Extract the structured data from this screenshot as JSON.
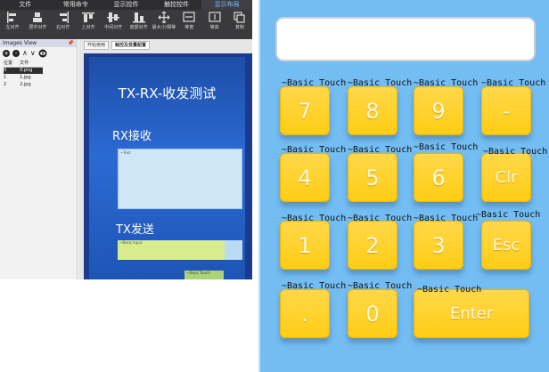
{
  "ide": {
    "menu_tabs": [
      "文件",
      "常用命令",
      "显示控件",
      "触控控件",
      "显示布局"
    ],
    "toolbar": [
      {
        "label": "左对齐",
        "icon": "align-left-icon"
      },
      {
        "label": "居中对齐",
        "icon": "align-center-icon"
      },
      {
        "label": "右对齐",
        "icon": "align-right-icon"
      },
      {
        "label": "上对齐",
        "icon": "align-top-icon"
      },
      {
        "label": "中间对齐",
        "icon": "align-middle-icon"
      },
      {
        "label": "底部对齐",
        "icon": "align-bottom-icon"
      },
      {
        "label": "最大小/相等",
        "icon": "resize-equal-icon"
      },
      {
        "label": "等宽",
        "icon": "equal-width-icon"
      },
      {
        "label": "等高",
        "icon": "equal-height-icon"
      },
      {
        "label": "复制",
        "icon": "copy-icon"
      }
    ],
    "images_view": {
      "title": "Images View",
      "pin": "📌",
      "add_icon": "+",
      "remove_icon": "-",
      "up_icon": "∧",
      "down_icon": "∨",
      "view_icon": "eye-icon",
      "columns": [
        "位置",
        "文件"
      ],
      "rows": [
        {
          "pos": "0",
          "file": "0.png",
          "selected": true
        },
        {
          "pos": "1",
          "file": "1.jpg",
          "selected": false
        },
        {
          "pos": "2",
          "file": "2.jpg",
          "selected": false
        }
      ]
    },
    "doc_tabs": [
      "开始使用",
      "触控及变量配置"
    ],
    "screen": {
      "title": "TX-RX-收发测试",
      "rx_label": "RX接收",
      "rx_text": "~Text",
      "tx_label": "TX发送",
      "tx_text": "~Basic Input",
      "send_text": "~Basic Touch"
    }
  },
  "keypad": {
    "caption": "~Basic Touch",
    "keys": [
      {
        "label": "7"
      },
      {
        "label": "8"
      },
      {
        "label": "9"
      },
      {
        "label": "-"
      },
      {
        "label": "4"
      },
      {
        "label": "5"
      },
      {
        "label": "6"
      },
      {
        "label": "Clr"
      },
      {
        "label": "1"
      },
      {
        "label": "2"
      },
      {
        "label": "3"
      },
      {
        "label": "Esc"
      },
      {
        "label": "."
      },
      {
        "label": "0"
      },
      {
        "label": "Enter"
      }
    ],
    "colors": {
      "background": "#73bdf3",
      "key": "#ffcd15",
      "key_text": "#fff8da"
    }
  }
}
